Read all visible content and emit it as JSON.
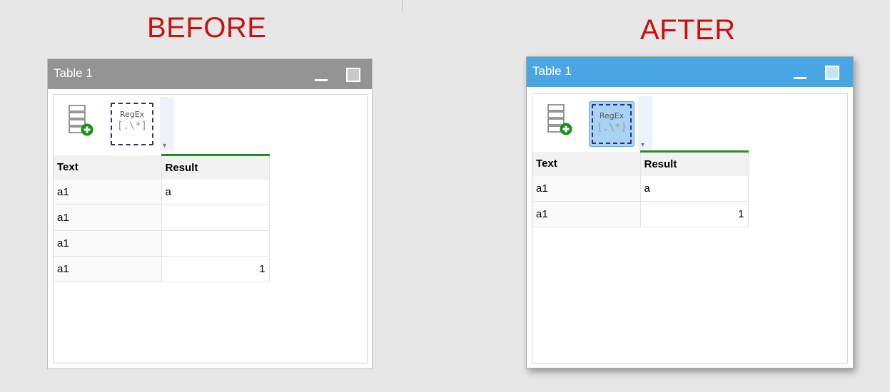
{
  "captions": {
    "before": "BEFORE",
    "after": "AFTER"
  },
  "before": {
    "window_title": "Table 1",
    "regex_icon": {
      "top": "RegEx",
      "bottom": "[.\\*]"
    },
    "columns": [
      "Text",
      "Result"
    ],
    "rows": [
      [
        "a1",
        "a"
      ],
      [
        "a1",
        ""
      ],
      [
        "a1",
        ""
      ],
      [
        "a1",
        "1"
      ]
    ],
    "title_bar_color": "#949494"
  },
  "after": {
    "window_title": "Table 1",
    "regex_icon": {
      "top": "RegEx",
      "bottom": "[.\\*]"
    },
    "columns": [
      "Text",
      "Result"
    ],
    "rows": [
      [
        "a1",
        "a"
      ],
      [
        "a1",
        "1"
      ]
    ],
    "title_bar_color": "#4aa5e3"
  },
  "icons": {
    "add_column": "add-column-icon",
    "regex": "regex-icon",
    "minimize": "minimize-icon",
    "maximize": "maximize-icon",
    "toolbar_overflow": "chevron-down-icon"
  },
  "colors": {
    "caption": "#c8110f",
    "result_header_accent": "#2a8c2a",
    "add_badge": "#1a8f1a"
  }
}
